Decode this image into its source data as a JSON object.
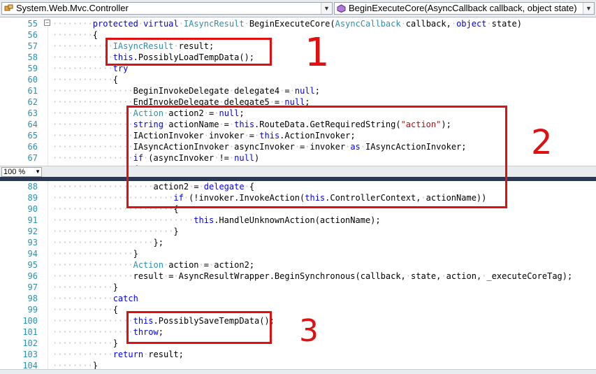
{
  "navigation": {
    "type_combo": "System.Web.Mvc.Controller",
    "member_combo": "BeginExecuteCore(AsyncCallback callback, object state)"
  },
  "zoom_level": "100 %",
  "top_lines": [
    {
      "n": "55",
      "tokens": [
        [
          "w",
          "········"
        ],
        [
          "k",
          "protected"
        ],
        [
          "w",
          "·"
        ],
        [
          "k",
          "virtual"
        ],
        [
          "w",
          "·"
        ],
        [
          "t",
          "IAsyncResult"
        ],
        [
          "w",
          "·"
        ],
        [
          "",
          "BeginExecuteCore("
        ],
        [
          "t",
          "AsyncCallback"
        ],
        [
          "w",
          "·"
        ],
        [
          "",
          "callback,"
        ],
        [
          "w",
          "·"
        ],
        [
          "k",
          "object"
        ],
        [
          "w",
          "·"
        ],
        [
          "",
          "state)"
        ]
      ]
    },
    {
      "n": "56",
      "tokens": [
        [
          "w",
          "········"
        ],
        [
          "",
          "{"
        ]
      ]
    },
    {
      "n": "57",
      "tokens": [
        [
          "w",
          "············"
        ],
        [
          "t",
          "IAsyncResult"
        ],
        [
          "w",
          "·"
        ],
        [
          "",
          "result;"
        ]
      ]
    },
    {
      "n": "58",
      "tokens": [
        [
          "w",
          "············"
        ],
        [
          "k",
          "this"
        ],
        [
          "",
          ".PossiblyLoadTempData();"
        ]
      ]
    },
    {
      "n": "59",
      "tokens": [
        [
          "w",
          "············"
        ],
        [
          "k",
          "try"
        ]
      ]
    },
    {
      "n": "60",
      "tokens": [
        [
          "w",
          "············"
        ],
        [
          "",
          "{"
        ]
      ]
    },
    {
      "n": "61",
      "tokens": [
        [
          "w",
          "················"
        ],
        [
          "",
          "BeginInvokeDelegate"
        ],
        [
          "w",
          "·"
        ],
        [
          "",
          "delegate4"
        ],
        [
          "w",
          "·"
        ],
        [
          "",
          "="
        ],
        [
          "w",
          "·"
        ],
        [
          "k",
          "null"
        ],
        [
          ";",
          ""
        ]
      ]
    },
    {
      "n": "62",
      "tokens": [
        [
          "w",
          "················"
        ],
        [
          "",
          "EndInvokeDelegate"
        ],
        [
          "w",
          "·"
        ],
        [
          "",
          "delegate5"
        ],
        [
          "w",
          "·"
        ],
        [
          "",
          "="
        ],
        [
          "w",
          "·"
        ],
        [
          "k",
          "null"
        ],
        [
          ";",
          ""
        ]
      ]
    },
    {
      "n": "63",
      "tokens": [
        [
          "w",
          "················"
        ],
        [
          "t",
          "Action"
        ],
        [
          "w",
          "·"
        ],
        [
          "",
          "action2"
        ],
        [
          "w",
          "·"
        ],
        [
          "",
          "="
        ],
        [
          "w",
          "·"
        ],
        [
          "k",
          "null"
        ],
        [
          ";",
          ""
        ]
      ]
    },
    {
      "n": "64",
      "tokens": [
        [
          "w",
          "················"
        ],
        [
          "k",
          "string"
        ],
        [
          "w",
          "·"
        ],
        [
          "",
          "actionName"
        ],
        [
          "w",
          "·"
        ],
        [
          "",
          "="
        ],
        [
          "w",
          "·"
        ],
        [
          "k",
          "this"
        ],
        [
          "",
          ".RouteData.GetRequiredString("
        ],
        [
          "s",
          "\"action\""
        ],
        [
          "",
          ");"
        ]
      ]
    },
    {
      "n": "65",
      "tokens": [
        [
          "w",
          "················"
        ],
        [
          "",
          "IActionInvoker"
        ],
        [
          "w",
          "·"
        ],
        [
          "",
          "invoker"
        ],
        [
          "w",
          "·"
        ],
        [
          "",
          "="
        ],
        [
          "w",
          "·"
        ],
        [
          "k",
          "this"
        ],
        [
          "",
          ".ActionInvoker;"
        ]
      ]
    },
    {
      "n": "66",
      "tokens": [
        [
          "w",
          "················"
        ],
        [
          "",
          "IAsyncActionInvoker"
        ],
        [
          "w",
          "·"
        ],
        [
          "",
          "asyncInvoker"
        ],
        [
          "w",
          "·"
        ],
        [
          "",
          "="
        ],
        [
          "w",
          "·"
        ],
        [
          "",
          "invoker"
        ],
        [
          "w",
          "·"
        ],
        [
          "k",
          "as"
        ],
        [
          "w",
          "·"
        ],
        [
          "",
          "IAsyncActionInvoker;"
        ]
      ]
    },
    {
      "n": "67",
      "tokens": [
        [
          "w",
          "················"
        ],
        [
          "k",
          "if"
        ],
        [
          "w",
          "·"
        ],
        [
          "",
          "(asyncInvoker"
        ],
        [
          "w",
          "·"
        ],
        [
          "",
          "!="
        ],
        [
          "w",
          "·"
        ],
        [
          "k",
          "null"
        ],
        [
          "",
          ")"
        ]
      ]
    },
    {
      "n": "",
      "tokens": [
        [
          "w",
          "················"
        ],
        [
          "",
          "{"
        ]
      ]
    }
  ],
  "bottom_lines": [
    {
      "n": "88",
      "tokens": [
        [
          "w",
          "····················"
        ],
        [
          "",
          "action2"
        ],
        [
          "w",
          "·"
        ],
        [
          "",
          "="
        ],
        [
          "w",
          "·"
        ],
        [
          "k",
          "delegate"
        ],
        [
          "w",
          "·"
        ],
        [
          "",
          "{"
        ]
      ]
    },
    {
      "n": "89",
      "tokens": [
        [
          "w",
          "························"
        ],
        [
          "k",
          "if"
        ],
        [
          "w",
          "·"
        ],
        [
          "",
          "(!invoker.InvokeAction("
        ],
        [
          "k",
          "this"
        ],
        [
          "",
          ".ControllerContext,"
        ],
        [
          "w",
          "·"
        ],
        [
          "",
          "actionName))"
        ]
      ]
    },
    {
      "n": "90",
      "tokens": [
        [
          "w",
          "························"
        ],
        [
          "",
          "{"
        ]
      ]
    },
    {
      "n": "91",
      "tokens": [
        [
          "w",
          "····························"
        ],
        [
          "k",
          "this"
        ],
        [
          "",
          ".HandleUnknownAction(actionName);"
        ]
      ]
    },
    {
      "n": "92",
      "tokens": [
        [
          "w",
          "························"
        ],
        [
          "",
          "}"
        ]
      ]
    },
    {
      "n": "93",
      "tokens": [
        [
          "w",
          "····················"
        ],
        [
          "",
          "};"
        ]
      ]
    },
    {
      "n": "94",
      "tokens": [
        [
          "w",
          "················"
        ],
        [
          "",
          "}"
        ]
      ]
    },
    {
      "n": "95",
      "tokens": [
        [
          "w",
          "················"
        ],
        [
          "t",
          "Action"
        ],
        [
          "w",
          "·"
        ],
        [
          "",
          "action"
        ],
        [
          "w",
          "·"
        ],
        [
          "",
          "="
        ],
        [
          "w",
          "·"
        ],
        [
          "",
          "action2;"
        ]
      ]
    },
    {
      "n": "96",
      "tokens": [
        [
          "w",
          "················"
        ],
        [
          "",
          "result"
        ],
        [
          "w",
          "·"
        ],
        [
          "",
          "="
        ],
        [
          "w",
          "·"
        ],
        [
          "",
          "AsyncResultWrapper.BeginSynchronous(callback,"
        ],
        [
          "w",
          "·"
        ],
        [
          "",
          "state,"
        ],
        [
          "w",
          "·"
        ],
        [
          "",
          "action,"
        ],
        [
          "w",
          "·"
        ],
        [
          "",
          "_executeCoreTag);"
        ]
      ]
    },
    {
      "n": "97",
      "tokens": [
        [
          "w",
          "············"
        ],
        [
          "",
          "}"
        ]
      ]
    },
    {
      "n": "98",
      "tokens": [
        [
          "w",
          "············"
        ],
        [
          "k",
          "catch"
        ]
      ]
    },
    {
      "n": "99",
      "tokens": [
        [
          "w",
          "············"
        ],
        [
          "",
          "{"
        ]
      ]
    },
    {
      "n": "100",
      "tokens": [
        [
          "w",
          "················"
        ],
        [
          "k",
          "this"
        ],
        [
          "",
          ".PossiblySaveTempData();"
        ]
      ]
    },
    {
      "n": "101",
      "tokens": [
        [
          "w",
          "················"
        ],
        [
          "k",
          "throw"
        ],
        [
          ";",
          ""
        ]
      ]
    },
    {
      "n": "102",
      "tokens": [
        [
          "w",
          "············"
        ],
        [
          "",
          "}"
        ]
      ]
    },
    {
      "n": "103",
      "tokens": [
        [
          "w",
          "············"
        ],
        [
          "k",
          "return"
        ],
        [
          "w",
          "·"
        ],
        [
          "",
          "result;"
        ]
      ]
    },
    {
      "n": "104",
      "tokens": [
        [
          "w",
          "········"
        ],
        [
          "",
          "}"
        ]
      ]
    }
  ],
  "annotations": [
    "1",
    "2",
    "3"
  ],
  "colors": {
    "keyword": "#0000ff",
    "type": "#2b91af",
    "string": "#a31515",
    "highlight": "#e01010"
  },
  "icons": {
    "type_combo": "class-icon",
    "member_combo": "method-icon"
  }
}
